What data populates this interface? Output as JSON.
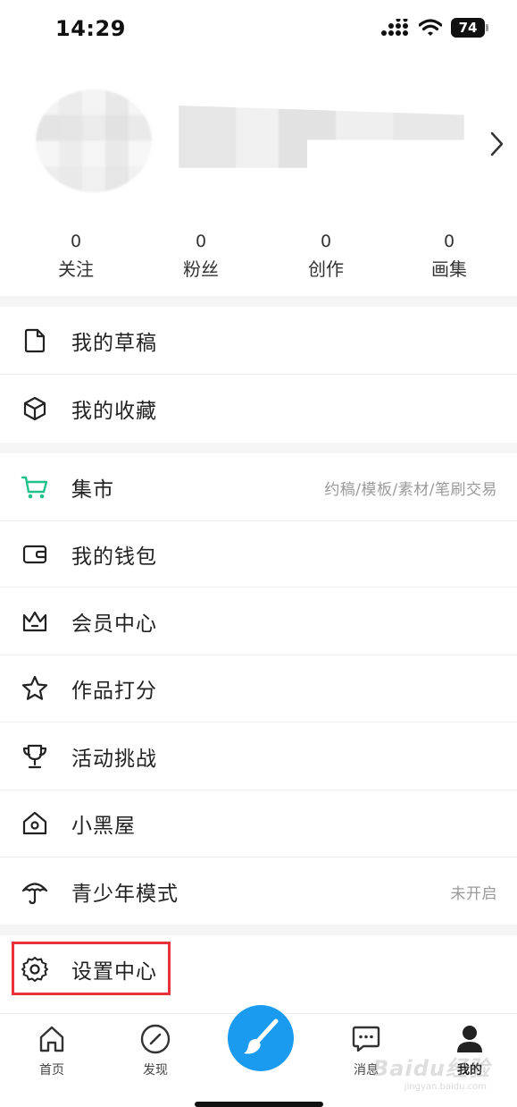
{
  "status_bar": {
    "time": "14:29",
    "battery": "74"
  },
  "stats": [
    {
      "count": "0",
      "label": "关注"
    },
    {
      "count": "0",
      "label": "粉丝"
    },
    {
      "count": "0",
      "label": "创作"
    },
    {
      "count": "0",
      "label": "画集"
    }
  ],
  "menu": {
    "drafts": {
      "label": "我的草稿",
      "icon": "file-icon"
    },
    "favorites": {
      "label": "我的收藏",
      "icon": "box-icon"
    },
    "market": {
      "label": "集市",
      "sub": "约稿/模板/素材/笔刷交易",
      "icon": "cart-icon",
      "icon_color": "#1fc38a"
    },
    "wallet": {
      "label": "我的钱包",
      "icon": "wallet-icon"
    },
    "membership": {
      "label": "会员中心",
      "icon": "crown-icon"
    },
    "rating": {
      "label": "作品打分",
      "icon": "star-icon"
    },
    "challenge": {
      "label": "活动挑战",
      "icon": "trophy-icon"
    },
    "blackroom": {
      "label": "小黑屋",
      "icon": "house-icon"
    },
    "teen_mode": {
      "label": "青少年模式",
      "sub": "未开启",
      "icon": "umbrella-icon"
    },
    "settings": {
      "label": "设置中心",
      "icon": "gear-icon"
    }
  },
  "bottom_nav": {
    "home": "首页",
    "discover": "发现",
    "messages": "消息",
    "mine": "我的"
  },
  "colors": {
    "accent_blue": "#1a9bf0",
    "highlight_red": "#e8313b",
    "market_green": "#1fc38a"
  },
  "watermark": {
    "brand": "Baidu经验",
    "url": "jingyan.baidu.com"
  }
}
